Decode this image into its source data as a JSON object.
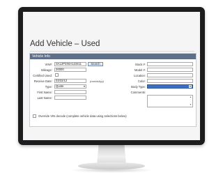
{
  "page": {
    "title": "Add Vehicle – Used"
  },
  "panel": {
    "header": "Vehicle Info"
  },
  "left": {
    "vin_label": "VIN#:",
    "vin_value": "SAL2P3X6A123411",
    "search_label": "Search",
    "mileage_label": "Mileage:",
    "mileage_value": "20000",
    "certified_label": "Certified Used:",
    "receive_label": "Receive Date:",
    "receive_value": "03/22/12",
    "receive_hint": "(mm/dd/yy)",
    "type_label": "Type:",
    "type_value": "Quote",
    "first_label": "First Name:",
    "last_label": "Last Name:"
  },
  "right": {
    "stock_label": "Stock #:",
    "model_label": "Model #:",
    "location_label": "Location:",
    "color_label": "Color:",
    "body_label": "Body Type:",
    "body_value": "",
    "comments_label": "Comments:"
  },
  "override": {
    "label": "Override VIN decode (complete vehicle data using selections below)"
  },
  "colors": {
    "header": "#5e6f8a",
    "selected_field": "#3e6fc3"
  }
}
